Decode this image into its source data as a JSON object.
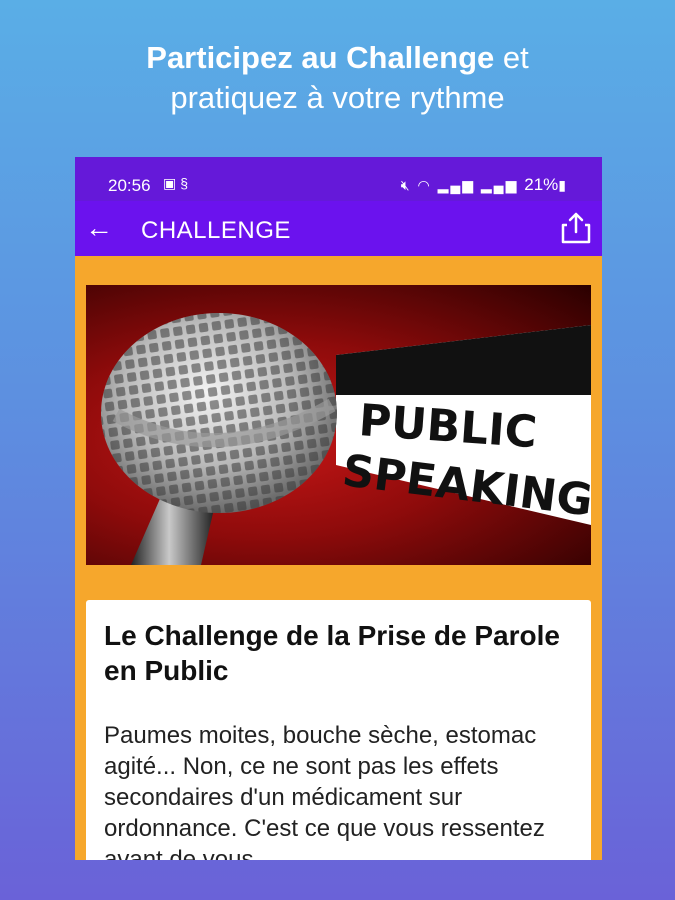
{
  "promo": {
    "line1_bold": "Participez au Challenge",
    "line1_rest": " et",
    "line2": "pratiquez à votre rythme"
  },
  "statusbar": {
    "time": "20:56",
    "battery": "21%"
  },
  "appbar": {
    "title": "CHALLENGE"
  },
  "hero": {
    "text_line1": "PUBLIC",
    "text_line2": "SPEAKING"
  },
  "card": {
    "title": "Le Challenge de la Prise de Parole en Public",
    "body": "Paumes moites, bouche sèche, estomac agité... Non, ce ne sont pas les effets secondaires d'un médicament sur ordonnance. C'est ce que vous ressentez avant de vous"
  },
  "colors": {
    "statusbar": "#6519d9",
    "appbar": "#6b12ee",
    "content_bg": "#f6a72c"
  }
}
